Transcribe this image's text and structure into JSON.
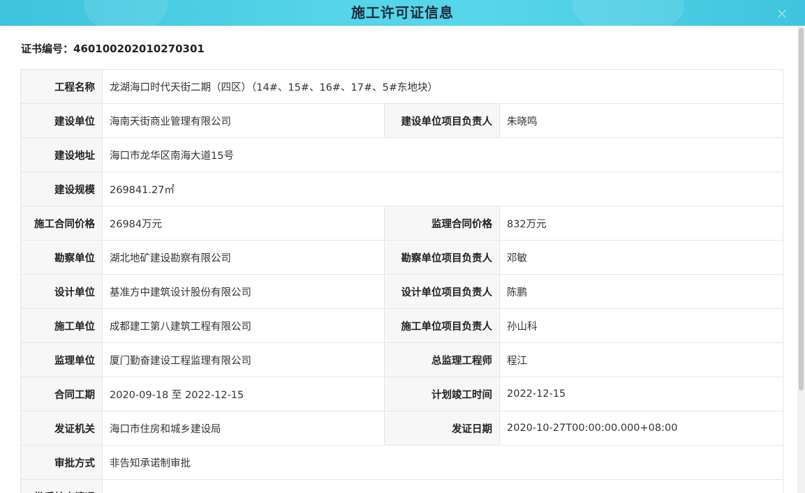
{
  "dialog": {
    "title": "施工许可证信息",
    "close_icon": "×"
  },
  "cert_line": "证书编号：460100202010270301",
  "colors": {
    "title_bar": "#4fcfe4",
    "label_bg": "#f7f7f7",
    "border": "#e6e6e6"
  },
  "rows": [
    {
      "label": "工程名称",
      "value": "龙湖海口时代天街二期（四区）（14#、15#、16#、17#、5#东地块）"
    },
    {
      "label": "建设单位",
      "value": "海南天街商业管理有限公司",
      "label2": "建设单位项目负责人",
      "value2": "朱晓鸣"
    },
    {
      "label": "建设地址",
      "value": "海口市龙华区南海大道15号"
    },
    {
      "label": "建设规模",
      "value": "269841.27㎡"
    },
    {
      "label": "施工合同价格",
      "value": "26984万元",
      "label2": "监理合同价格",
      "value2": "832万元"
    },
    {
      "label": "勘察单位",
      "value": "湖北地矿建设勘察有限公司",
      "label2": "勘察单位项目负责人",
      "value2": "邓敏"
    },
    {
      "label": "设计单位",
      "value": "基准方中建筑设计股份有限公司",
      "label2": "设计单位项目负责人",
      "value2": "陈鹏"
    },
    {
      "label": "施工单位",
      "value": "成都建工第八建筑工程有限公司",
      "label2": "施工单位项目负责人",
      "value2": "孙山科"
    },
    {
      "label": "监理单位",
      "value": "厦门勤奋建设工程监理有限公司",
      "label2": "总监理工程师",
      "value2": "程江"
    },
    {
      "label": "合同工期",
      "value": "2020-09-18 至 2022-12-15",
      "label2": "计划竣工时间",
      "value2": "2022-12-15"
    },
    {
      "label": "发证机关",
      "value": "海口市住房和城乡建设局",
      "label2": "发证日期",
      "value2": "2020-10-27T00:00:00.000+08:00"
    },
    {
      "label": "审批方式",
      "value": "非告知承诺制审批"
    },
    {
      "label": "批后核查情况",
      "value": ""
    }
  ]
}
